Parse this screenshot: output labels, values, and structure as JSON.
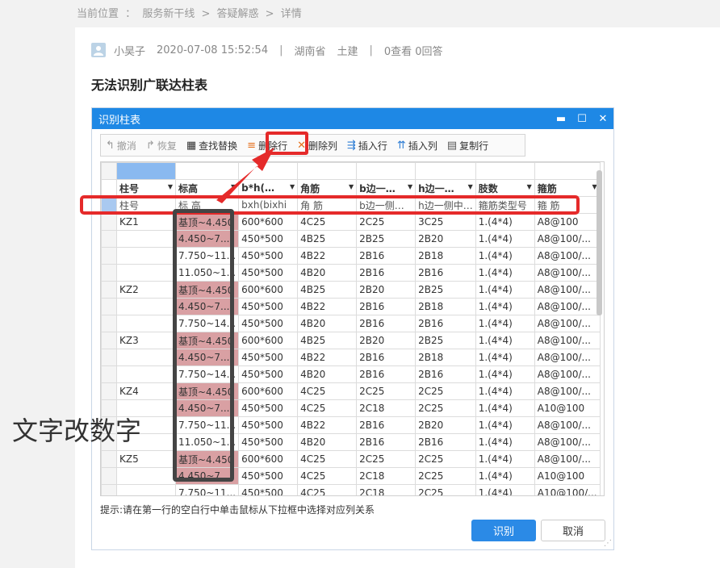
{
  "breadcrumb": {
    "prefix": "当前位置",
    "sep1": "：",
    "l1": "服务新干线",
    "sep2": ">",
    "l2": "答疑解惑",
    "sep3": ">",
    "l3": "详情"
  },
  "post": {
    "author": "小昊子",
    "datetime": "2020-07-08 15:52:54",
    "divider": "|",
    "province": "湖南省",
    "category": "土建",
    "views": "0查看",
    "answers": "0回答",
    "title": "无法识别广联达柱表"
  },
  "dialog": {
    "title": "识别柱表",
    "window_controls": {
      "minimize": "▬",
      "maximize": "☐",
      "close": "✕"
    },
    "toolbar": {
      "undo": "撤消",
      "redo": "恢复",
      "find_replace": "查找替换",
      "delete_row": "删除行",
      "delete_col": "删除列",
      "insert_row": "插入行",
      "insert_col": "插入列",
      "copy_row": "复制行"
    },
    "headers": [
      "柱号",
      "标高",
      "b*h(…",
      "角筋",
      "b边一…",
      "h边一…",
      "肢数",
      "箍筋"
    ],
    "mapping": [
      "柱号",
      "标 高",
      "bxh(bixhi",
      "角 筋",
      "b边一侧…",
      "h边一侧中…",
      "箍筋类型号",
      "箍 筋"
    ],
    "rows": [
      [
        "KZ1",
        "基顶~4.450",
        "600*600",
        "4C25",
        "2C25",
        "3C25",
        "1.(4*4)",
        "A8@100"
      ],
      [
        "",
        "4.450~7....",
        "450*500",
        "4B25",
        "2B25",
        "2B20",
        "1.(4*4)",
        "A8@100/..."
      ],
      [
        "",
        "7.750~11...",
        "450*500",
        "4B22",
        "2B16",
        "2B18",
        "1.(4*4)",
        "A8@100/..."
      ],
      [
        "",
        "11.050~1...",
        "450*500",
        "4B20",
        "2B16",
        "2B16",
        "1.(4*4)",
        "A8@100/..."
      ],
      [
        "KZ2",
        "基顶~4.450",
        "600*600",
        "4B25",
        "2B20",
        "2B25",
        "1.(4*4)",
        "A8@100/..."
      ],
      [
        "",
        "4.450~7....",
        "450*500",
        "4B22",
        "2B16",
        "2B18",
        "1.(4*4)",
        "A8@100/..."
      ],
      [
        "",
        "7.750~14...",
        "450*500",
        "4B20",
        "2B16",
        "2B16",
        "1.(4*4)",
        "A8@100/..."
      ],
      [
        "KZ3",
        "基顶~4.450",
        "600*600",
        "4B25",
        "2B20",
        "2B25",
        "1.(4*4)",
        "A8@100/..."
      ],
      [
        "",
        "4.450~7....",
        "450*500",
        "4B22",
        "2B16",
        "2B18",
        "1.(4*4)",
        "A8@100/..."
      ],
      [
        "",
        "7.750~14...",
        "450*500",
        "4B20",
        "2B16",
        "2B16",
        "1.(4*4)",
        "A8@100/..."
      ],
      [
        "KZ4",
        "基顶~4.450",
        "600*600",
        "4C25",
        "2C25",
        "2C25",
        "1.(4*4)",
        "A8@100/..."
      ],
      [
        "",
        "4.450~7....",
        "450*500",
        "4C25",
        "2C18",
        "2C25",
        "1.(4*4)",
        "A10@100"
      ],
      [
        "",
        "7.750~11...",
        "450*500",
        "4B22",
        "2B16",
        "2B20",
        "1.(4*4)",
        "A8@100/..."
      ],
      [
        "",
        "11.050~1...",
        "450*500",
        "4B20",
        "2B16",
        "2B16",
        "1.(4*4)",
        "A8@100/..."
      ],
      [
        "KZ5",
        "基顶~4.450",
        "600*600",
        "4C25",
        "2C25",
        "2C25",
        "1.(4*4)",
        "A8@100/..."
      ],
      [
        "",
        "4.450~7....",
        "450*500",
        "4C25",
        "2C18",
        "2C25",
        "1.(4*4)",
        "A10@100"
      ],
      [
        "",
        "7.750~11...",
        "450*500",
        "4C25",
        "2C18",
        "2C25",
        "1.(4*4)",
        "A10@100/..."
      ]
    ],
    "hint": "提示:请在第一行的空白行中单击鼠标从下拉框中选择对应列关系",
    "ok": "识别",
    "cancel": "取消"
  },
  "annotation": "文字改数字",
  "colors": {
    "title_bar": "#1e88e5",
    "highlight_red": "#e52a2a",
    "pink_cell": "#d9a0a3",
    "ok_button": "#2b8ae6"
  }
}
